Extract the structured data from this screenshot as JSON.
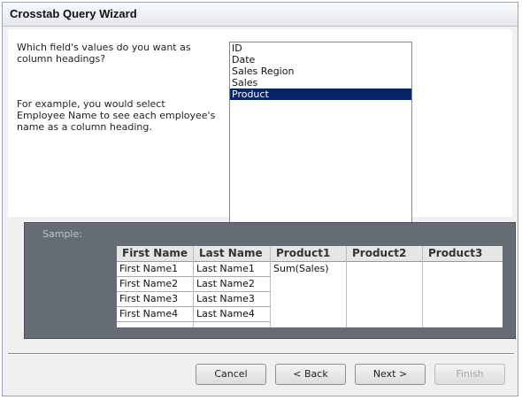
{
  "window": {
    "title": "Crosstab Query Wizard"
  },
  "prompt": {
    "question": "Which field's values do you want as column headings?",
    "example": "For example, you would select Employee Name to see each employee's name as a column heading."
  },
  "fields": {
    "items": [
      "ID",
      "Date",
      "Sales Region",
      "Sales",
      "Product"
    ],
    "selected": "Product"
  },
  "sample": {
    "label": "Sample:",
    "columns": [
      "First Name",
      "Last Name",
      "Product1",
      "Product2",
      "Product3"
    ],
    "first_names": [
      "First Name1",
      "First Name2",
      "First Name3",
      "First Name4"
    ],
    "last_names": [
      "Last Name1",
      "Last Name2",
      "Last Name3",
      "Last Name4"
    ],
    "value_cell": "Sum(Sales)"
  },
  "buttons": {
    "cancel": "Cancel",
    "back": "< Back",
    "next": "Next >",
    "finish": "Finish"
  }
}
